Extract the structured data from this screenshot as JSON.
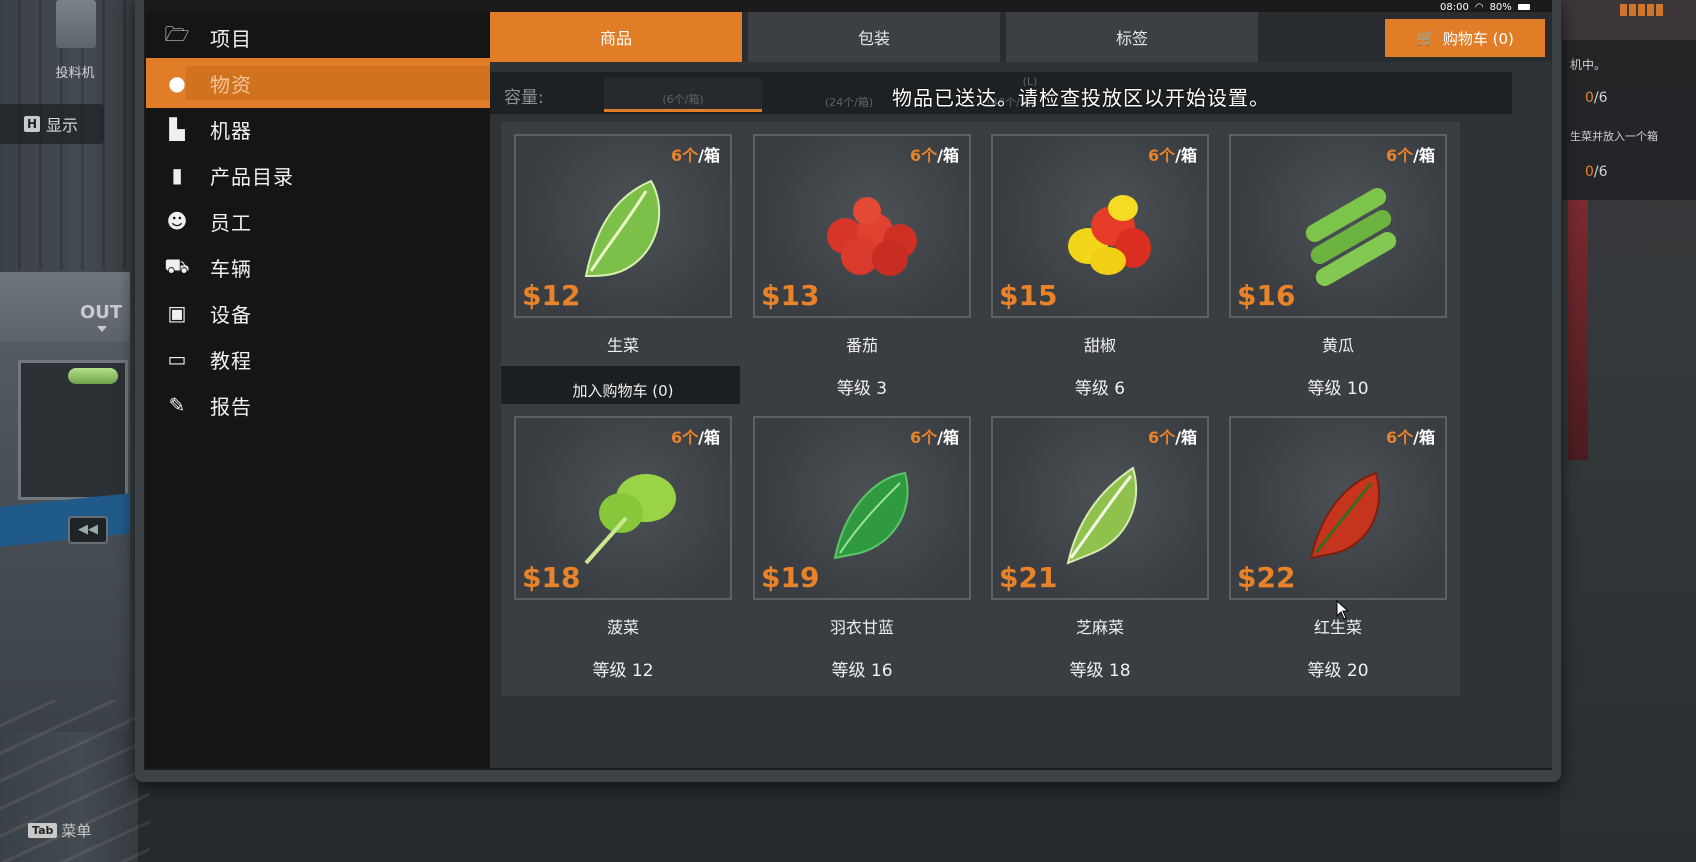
{
  "background": {
    "feeder_label": "投料机",
    "show_key": "H",
    "show_label": "显示",
    "out_label": "OUT",
    "tab_key": "Tab",
    "tab_label": "菜单",
    "objective_line1": "机中。",
    "objective_count1_done": "0",
    "objective_count1_total": "/6",
    "objective_line2": "生菜并放入一个箱",
    "objective_count2_done": "0",
    "objective_count2_total": "/6",
    "status_time": "08:00",
    "status_battery": "80%"
  },
  "sidebar": {
    "items": [
      {
        "label": "项目",
        "icon": "folder-icon"
      },
      {
        "label": "物资",
        "icon": "apple-icon"
      },
      {
        "label": "机器",
        "icon": "machine-icon"
      },
      {
        "label": "产品目录",
        "icon": "catalog-book-icon"
      },
      {
        "label": "员工",
        "icon": "employee-icon"
      },
      {
        "label": "车辆",
        "icon": "forklift-icon"
      },
      {
        "label": "设备",
        "icon": "equipment-box-icon"
      },
      {
        "label": "教程",
        "icon": "tutorial-book-icon"
      },
      {
        "label": "报告",
        "icon": "report-icon"
      }
    ],
    "active_index": 1
  },
  "tabs": [
    "商品",
    "包装",
    "标签"
  ],
  "active_tab": 0,
  "cart": {
    "label": "购物车 (0)"
  },
  "capacity": {
    "label": "容量:",
    "options": [
      "(6个/箱)",
      "(24个/箱)",
      "(48个/箱)"
    ],
    "small_label": "(L)"
  },
  "notice": "物品已送达。请检查投放区以开始设置。",
  "products": [
    {
      "name": "生菜",
      "price": "$12",
      "per_box_n": "6个",
      "per_box_unit": "/箱",
      "level": "",
      "action": "加入购物车 (0)",
      "color": "#6db33f"
    },
    {
      "name": "番茄",
      "price": "$13",
      "per_box_n": "6个",
      "per_box_unit": "/箱",
      "level": "等级 3",
      "action": "",
      "color": "#d83a2c"
    },
    {
      "name": "甜椒",
      "price": "$15",
      "per_box_n": "6个",
      "per_box_unit": "/箱",
      "level": "等级 6",
      "action": "",
      "color": "#e63b28"
    },
    {
      "name": "黄瓜",
      "price": "$16",
      "per_box_n": "6个",
      "per_box_unit": "/箱",
      "level": "等级 10",
      "action": "",
      "color": "#7cc44a"
    },
    {
      "name": "菠菜",
      "price": "$18",
      "per_box_n": "6个",
      "per_box_unit": "/箱",
      "level": "等级 12",
      "action": "",
      "color": "#8ccf3a"
    },
    {
      "name": "羽衣甘蓝",
      "price": "$19",
      "per_box_n": "6个",
      "per_box_unit": "/箱",
      "level": "等级 16",
      "action": "",
      "color": "#2f9a3f"
    },
    {
      "name": "芝麻菜",
      "price": "$21",
      "per_box_n": "6个",
      "per_box_unit": "/箱",
      "level": "等级 18",
      "action": "",
      "color": "#8fc24d"
    },
    {
      "name": "红生菜",
      "price": "$22",
      "per_box_n": "6个",
      "per_box_unit": "/箱",
      "level": "等级 20",
      "action": "",
      "color": "#c7341e"
    }
  ]
}
